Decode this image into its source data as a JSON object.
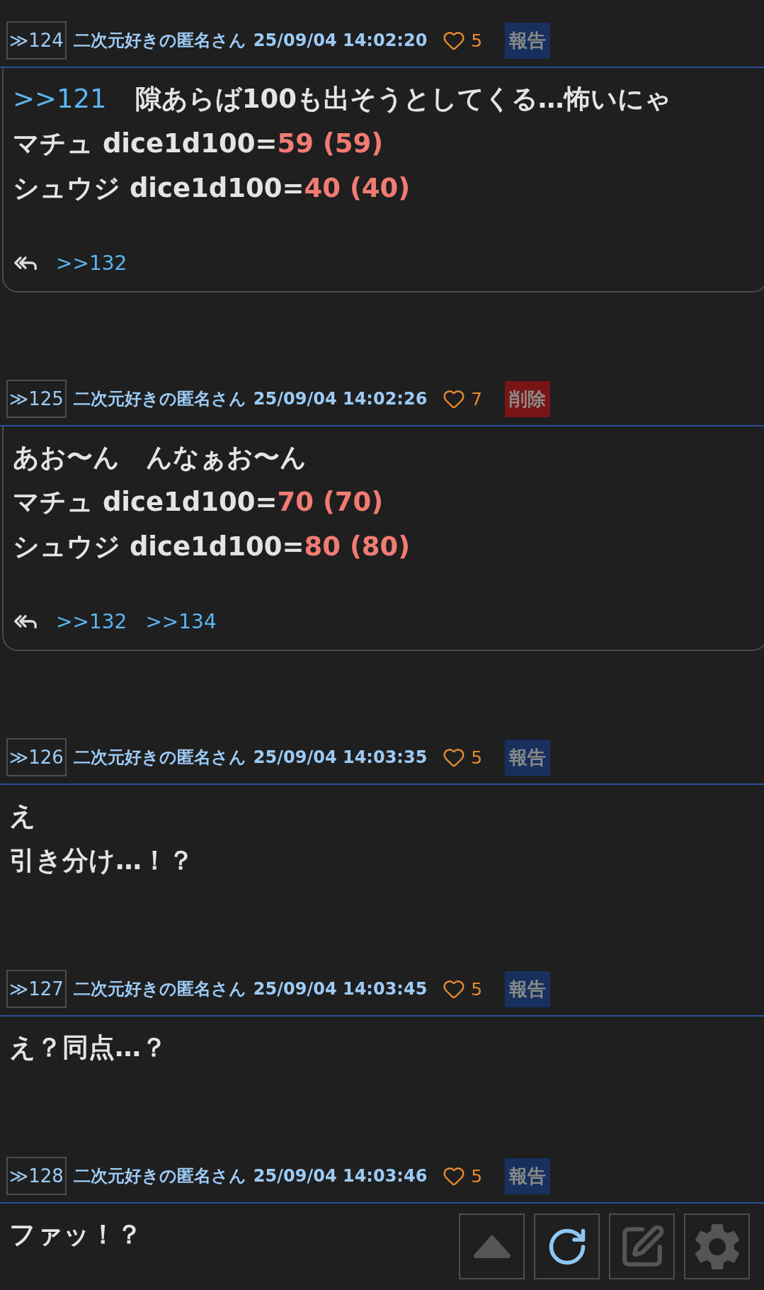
{
  "posts": [
    {
      "number": "≫124",
      "name": "二次元好きの匿名さん",
      "date": "25/09/04 14:02:20",
      "likes": "5",
      "action": {
        "kind": "report",
        "label": "報告"
      },
      "lines": [
        [
          {
            "kind": "anchor",
            "text": ">>121"
          },
          {
            "kind": "text",
            "text": "隙あらば100も出そうとしてくる…怖いにゃ"
          }
        ],
        [
          {
            "kind": "text",
            "text": "マチュ dice1d100="
          },
          {
            "kind": "dice",
            "text": "59 (59)"
          }
        ],
        [
          {
            "kind": "text",
            "text": "シュウジ dice1d100="
          },
          {
            "kind": "dice",
            "text": "40 (40)"
          }
        ]
      ],
      "replies": [
        ">>132"
      ]
    },
    {
      "number": "≫125",
      "name": "二次元好きの匿名さん",
      "date": "25/09/04 14:02:26",
      "likes": "7",
      "action": {
        "kind": "delete",
        "label": "削除"
      },
      "lines": [
        [
          {
            "kind": "text",
            "text": "あお〜ん　んなぁお〜ん"
          }
        ],
        [
          {
            "kind": "text",
            "text": "マチュ dice1d100="
          },
          {
            "kind": "dice",
            "text": "70 (70)"
          }
        ],
        [
          {
            "kind": "text",
            "text": "シュウジ dice1d100="
          },
          {
            "kind": "dice",
            "text": "80 (80)"
          }
        ]
      ],
      "replies": [
        ">>132",
        ">>134"
      ]
    },
    {
      "number": "≫126",
      "name": "二次元好きの匿名さん",
      "date": "25/09/04 14:03:35",
      "likes": "5",
      "action": {
        "kind": "report",
        "label": "報告"
      },
      "lines": [
        [
          {
            "kind": "text",
            "text": "え"
          }
        ],
        [
          {
            "kind": "text",
            "text": "引き分け…！？"
          }
        ]
      ]
    },
    {
      "number": "≫127",
      "name": "二次元好きの匿名さん",
      "date": "25/09/04 14:03:45",
      "likes": "5",
      "action": {
        "kind": "report",
        "label": "報告"
      },
      "lines": [
        [
          {
            "kind": "text",
            "text": "え？同点…？"
          }
        ]
      ]
    },
    {
      "number": "≫128",
      "name": "二次元好きの匿名さん",
      "date": "25/09/04 14:03:46",
      "likes": "5",
      "action": {
        "kind": "report",
        "label": "報告"
      },
      "lines": [
        [
          {
            "kind": "text",
            "text": "ファッ！？"
          }
        ]
      ]
    }
  ],
  "toolbar": [
    {
      "kind": "up"
    },
    {
      "kind": "reload"
    },
    {
      "kind": "edit"
    },
    {
      "kind": "settings"
    }
  ]
}
